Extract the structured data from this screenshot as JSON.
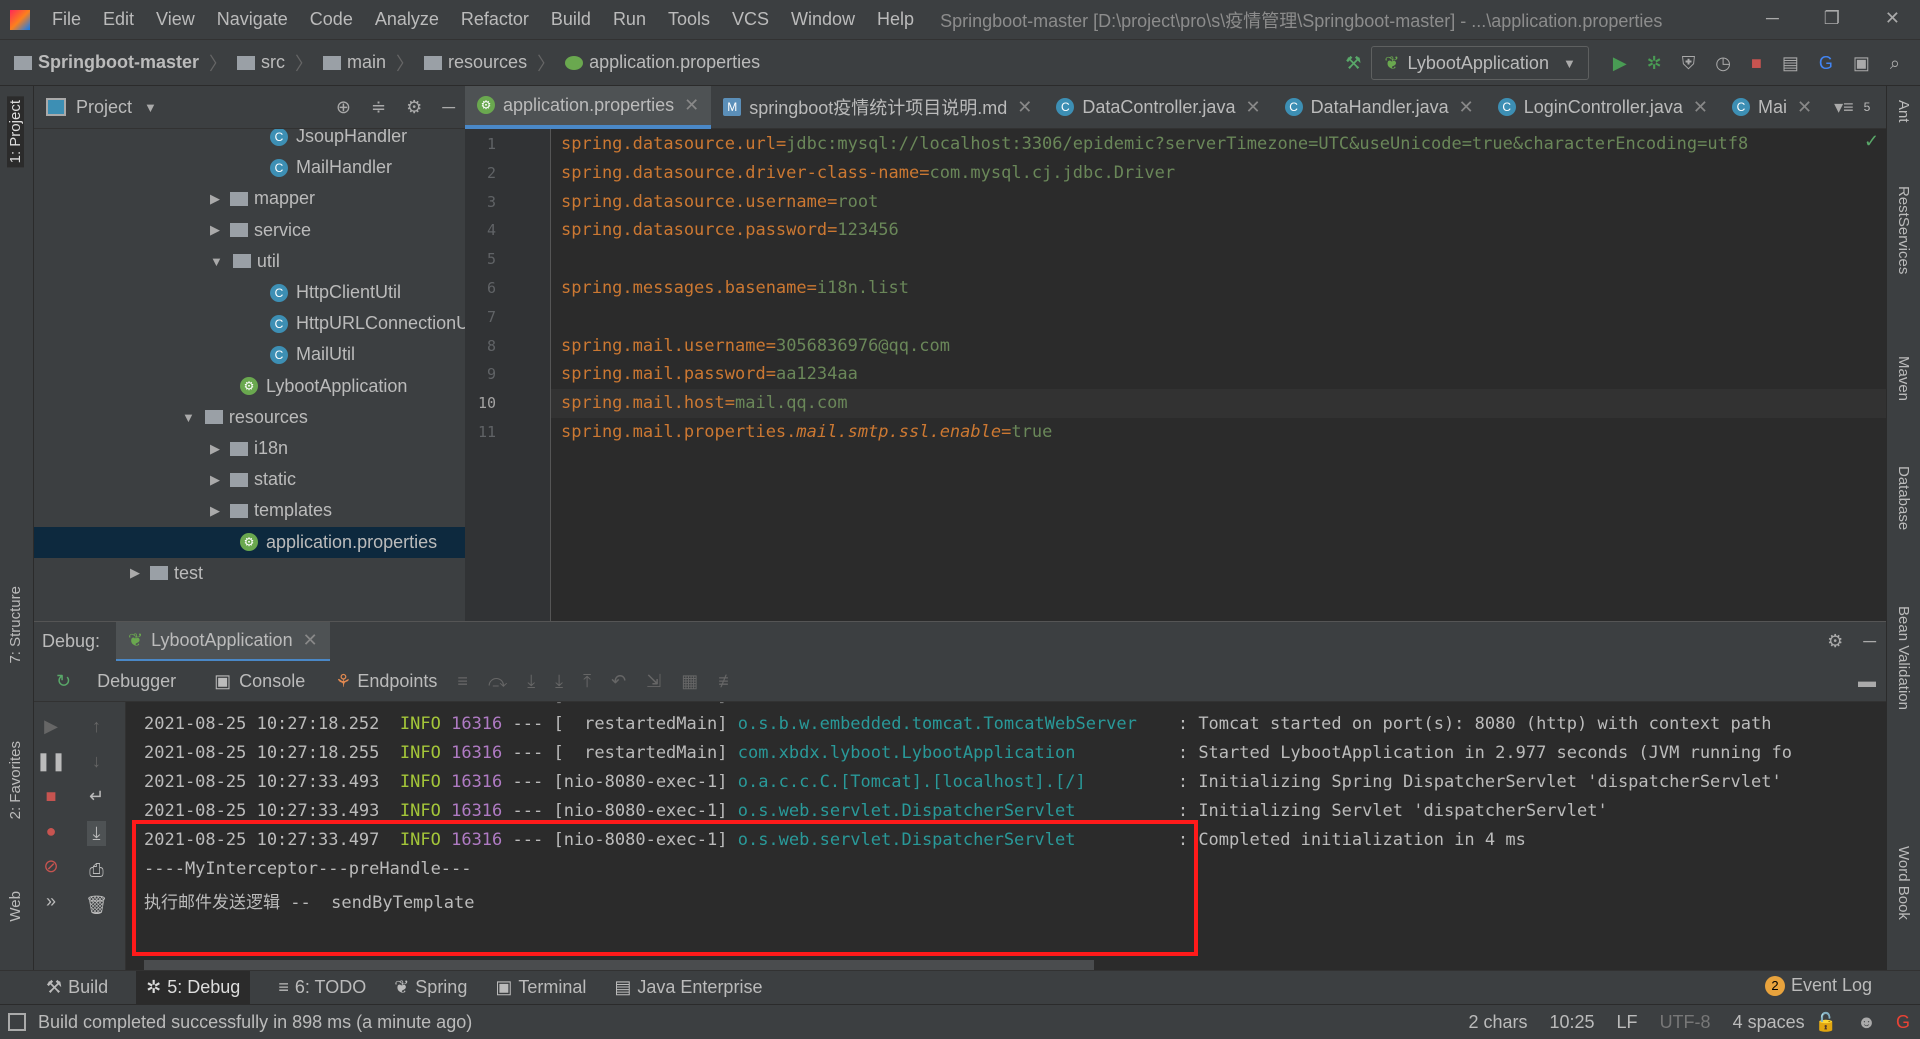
{
  "menu": [
    "File",
    "Edit",
    "View",
    "Navigate",
    "Code",
    "Analyze",
    "Refactor",
    "Build",
    "Run",
    "Tools",
    "VCS",
    "Window",
    "Help"
  ],
  "window_title": "Springboot-master [D:\\project\\pro\\s\\疫情管理\\Springboot-master] - ...\\application.properties",
  "breadcrumb": [
    "Springboot-master",
    "src",
    "main",
    "resources",
    "application.properties"
  ],
  "run_config": "LybootApplication",
  "project_panel": {
    "title": "Project",
    "items": [
      {
        "label": "JsoupHandler",
        "type": "class",
        "depth": 3
      },
      {
        "label": "MailHandler",
        "type": "class",
        "depth": 3
      },
      {
        "label": "mapper",
        "type": "folder",
        "depth": 2,
        "state": "collapsed"
      },
      {
        "label": "service",
        "type": "folder",
        "depth": 2,
        "state": "collapsed"
      },
      {
        "label": "util",
        "type": "folder",
        "depth": 2,
        "state": "expanded"
      },
      {
        "label": "HttpClientUtil",
        "type": "class",
        "depth": 3
      },
      {
        "label": "HttpURLConnectionUtil",
        "type": "class",
        "depth": 3
      },
      {
        "label": "MailUtil",
        "type": "class",
        "depth": 3
      },
      {
        "label": "LybootApplication",
        "type": "spring",
        "depth": 2
      },
      {
        "label": "resources",
        "type": "folder",
        "depth": 1,
        "state": "expanded"
      },
      {
        "label": "i18n",
        "type": "folder",
        "depth": 2,
        "state": "collapsed"
      },
      {
        "label": "static",
        "type": "folder",
        "depth": 2,
        "state": "collapsed"
      },
      {
        "label": "templates",
        "type": "folder",
        "depth": 2,
        "state": "collapsed"
      },
      {
        "label": "application.properties",
        "type": "properties",
        "depth": 2,
        "selected": true
      },
      {
        "label": "test",
        "type": "folder",
        "depth": 0,
        "state": "collapsed"
      }
    ]
  },
  "tabs": [
    {
      "label": "application.properties",
      "active": true
    },
    {
      "label": "springboot疫情统计项目说明.md"
    },
    {
      "label": "DataController.java"
    },
    {
      "label": "DataHandler.java"
    },
    {
      "label": "LoginController.java"
    },
    {
      "label": "Mai"
    }
  ],
  "tabs_overflow": "5",
  "editor": {
    "current_line": 10,
    "lines": [
      {
        "n": "1",
        "k": "spring.datasource.url",
        "v": "jdbc:mysql://localhost:3306/epidemic?serverTimezone=UTC&useUnicode=true&characterEncoding=utf8"
      },
      {
        "n": "2",
        "k": "spring.datasource.driver-class-name",
        "v": "com.mysql.cj.jdbc.Driver"
      },
      {
        "n": "3",
        "k": "spring.datasource.username",
        "v": "root"
      },
      {
        "n": "4",
        "k": "spring.datasource.password",
        "v": "123456"
      },
      {
        "n": "5",
        "k": "",
        "v": ""
      },
      {
        "n": "6",
        "k": "spring.messages.basename",
        "v": "i18n.list"
      },
      {
        "n": "7",
        "k": "",
        "v": ""
      },
      {
        "n": "8",
        "k": "spring.mail.username",
        "v": "3056836976@qq.com"
      },
      {
        "n": "9",
        "k": "spring.mail.password",
        "v": "aa1234aa"
      },
      {
        "n": "10",
        "k": "spring.mail.host",
        "v": "mail.qq.com"
      },
      {
        "n": "11",
        "k": "spring.mail.properties.",
        "ki": "mail.smtp.ssl.enable",
        "v": "true"
      }
    ]
  },
  "debug": {
    "label": "Debug:",
    "session": "LybootApplication",
    "tabs": [
      "Debugger",
      "Console",
      "Endpoints"
    ],
    "console": [
      {
        "ts": "2021-08-25 10:27:18.252",
        "lvl": "INFO",
        "pid": "16316",
        "th": "--- [  restartedMain]",
        "lg": "o.s.b.w.embedded.tomcat.TomcatWebServer ",
        "msg": ": Tomcat started on port(s): 8080 (http) with context path"
      },
      {
        "ts": "2021-08-25 10:27:18.255",
        "lvl": "INFO",
        "pid": "16316",
        "th": "--- [  restartedMain]",
        "lg": "com.xbdx.lyboot.LybootApplication       ",
        "msg": ": Started LybootApplication in 2.977 seconds (JVM running fo"
      },
      {
        "ts": "2021-08-25 10:27:33.493",
        "lvl": "INFO",
        "pid": "16316",
        "th": "--- [nio-8080-exec-1]",
        "lg": "o.a.c.c.C.[Tomcat].[localhost].[/]      ",
        "msg": ": Initializing Spring DispatcherServlet 'dispatcherServlet'"
      },
      {
        "ts": "2021-08-25 10:27:33.493",
        "lvl": "INFO",
        "pid": "16316",
        "th": "--- [nio-8080-exec-1]",
        "lg": "o.s.web.servlet.DispatcherServlet       ",
        "msg": ": Initializing Servlet 'dispatcherServlet'"
      },
      {
        "ts": "2021-08-25 10:27:33.497",
        "lvl": "INFO",
        "pid": "16316",
        "th": "--- [nio-8080-exec-1]",
        "lg": "o.s.web.servlet.DispatcherServlet       ",
        "msg": ": Completed initialization in 4 ms"
      }
    ],
    "plain": [
      "----MyInterceptor---preHandle---",
      "执行邮件发送逻辑 --  sendByTemplate"
    ],
    "highlight_color": "#ff1a1a"
  },
  "bottom_tabs": [
    "Build",
    "5: Debug",
    "6: TODO",
    "Spring",
    "Terminal",
    "Java Enterprise"
  ],
  "event_log": {
    "label": "Event Log",
    "count": "2"
  },
  "left_strip": [
    "1: Project",
    "7: Structure",
    "2: Favorites",
    "Web"
  ],
  "right_strip": [
    "Ant",
    "RestServices",
    "Maven",
    "Database",
    "Bean Validation",
    "Word Book"
  ],
  "status": {
    "message": "Build completed successfully in 898 ms (a minute ago)",
    "chars": "2 chars",
    "pos": "10:25",
    "sep": "LF",
    "enc": "UTF-8",
    "indent": "4 spaces"
  }
}
